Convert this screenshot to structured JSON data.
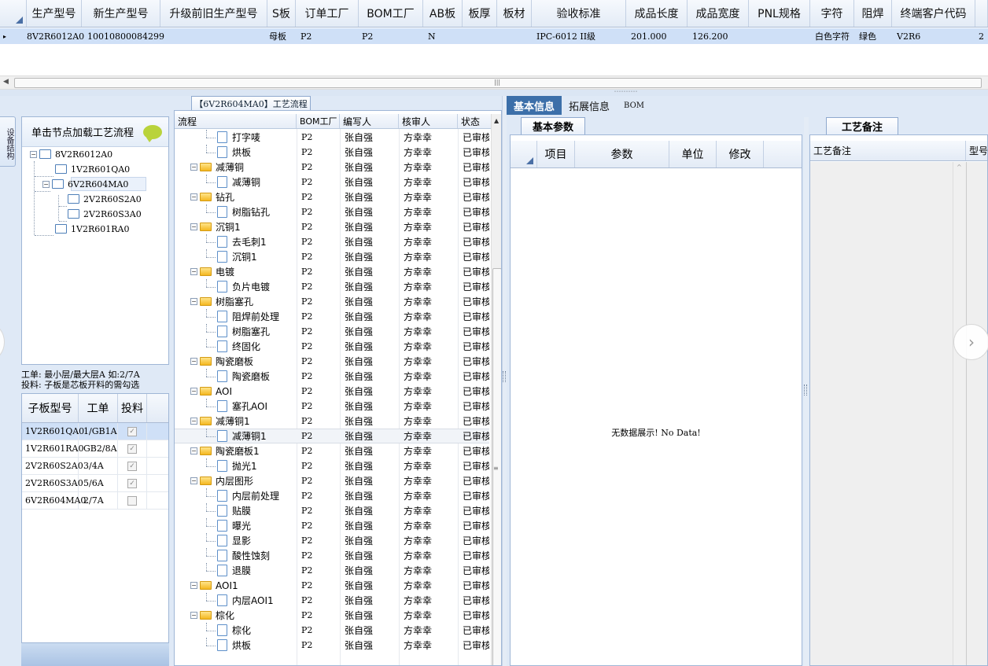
{
  "top_grid": {
    "columns": [
      "生产型号",
      "新生产型号",
      "升级前旧生产型号",
      "S板",
      "订单工厂",
      "BOM工厂",
      "AB板",
      "板厚",
      "板材",
      "验收标准",
      "成品长度",
      "成品宽度",
      "PNL规格",
      "字符",
      "阻焊",
      "终端客户代码"
    ],
    "row": {
      "selector": "▸",
      "cells": [
        "8V2R6012A0",
        "10010800084299",
        "",
        "母板",
        "P2",
        "P2",
        "N",
        "",
        "",
        "IPC-6012 II级",
        "201.000",
        "126.200",
        "",
        "白色字符",
        "绿色",
        "V2R6"
      ],
      "extra": "2"
    }
  },
  "h_splitter_dots": "˙˙˙˙˙˙˙˙˙˙",
  "left": {
    "side_tab": "设备结构",
    "tree_header": "单击节点加载工艺流程",
    "tree_nodes": [
      {
        "label": "8V2R6012A0",
        "expander": "−"
      },
      {
        "label": "1V2R601QA0",
        "expander": ""
      },
      {
        "label": "6V2R604MA0",
        "expander": "−"
      },
      {
        "label": "2V2R60S2A0",
        "expander": ""
      },
      {
        "label": "2V2R60S3A0",
        "expander": ""
      },
      {
        "label": "1V2R601RA0",
        "expander": ""
      }
    ],
    "note_line1": "工单: 最小层/最大层A 如:2/7A",
    "note_line2": "投料: 子板是芯板开料的需勾选",
    "sub_headers": [
      "子板型号",
      "工单",
      "投料"
    ],
    "sub_rows": [
      {
        "model": "1V2R601QA0",
        "order": "1/GB1A",
        "feed": "✓"
      },
      {
        "model": "1V2R601RA0",
        "order": "GB2/8A",
        "feed": "✓"
      },
      {
        "model": "2V2R60S2A0",
        "order": "3/4A",
        "feed": "✓"
      },
      {
        "model": "2V2R60S3A0",
        "order": "5/6A",
        "feed": "✓"
      },
      {
        "model": "6V2R604MA0",
        "order": "2/7A",
        "feed": ""
      }
    ]
  },
  "flow": {
    "tab_title": "【6V2R604MA0】工艺流程",
    "headers": [
      "流程",
      "BOM工厂",
      "编写人",
      "核审人",
      "状态"
    ],
    "scroll_up": "▲",
    "rows": [
      {
        "type": "doc",
        "name": "打字唛",
        "bom": "P2",
        "writer": "张自强",
        "reviewer": "方幸幸",
        "status": "已审核"
      },
      {
        "type": "doc",
        "name": "烘板",
        "bom": "P2",
        "writer": "张自强",
        "reviewer": "方幸幸",
        "status": "已审核"
      },
      {
        "type": "folder",
        "name": "减薄铜",
        "bom": "P2",
        "writer": "张自强",
        "reviewer": "方幸幸",
        "status": "已审核"
      },
      {
        "type": "doc",
        "name": "减薄铜",
        "bom": "P2",
        "writer": "张自强",
        "reviewer": "方幸幸",
        "status": "已审核"
      },
      {
        "type": "folder",
        "name": "钻孔",
        "bom": "P2",
        "writer": "张自强",
        "reviewer": "方幸幸",
        "status": "已审核"
      },
      {
        "type": "doc",
        "name": "树脂钻孔",
        "bom": "P2",
        "writer": "张自强",
        "reviewer": "方幸幸",
        "status": "已审核"
      },
      {
        "type": "folder",
        "name": "沉铜1",
        "bom": "P2",
        "writer": "张自强",
        "reviewer": "方幸幸",
        "status": "已审核"
      },
      {
        "type": "doc",
        "name": "去毛刺1",
        "bom": "P2",
        "writer": "张自强",
        "reviewer": "方幸幸",
        "status": "已审核"
      },
      {
        "type": "doc",
        "name": "沉铜1",
        "bom": "P2",
        "writer": "张自强",
        "reviewer": "方幸幸",
        "status": "已审核"
      },
      {
        "type": "folder",
        "name": "电镀",
        "bom": "P2",
        "writer": "张自强",
        "reviewer": "方幸幸",
        "status": "已审核"
      },
      {
        "type": "doc",
        "name": "负片电镀",
        "bom": "P2",
        "writer": "张自强",
        "reviewer": "方幸幸",
        "status": "已审核"
      },
      {
        "type": "folder",
        "name": "树脂塞孔",
        "bom": "P2",
        "writer": "张自强",
        "reviewer": "方幸幸",
        "status": "已审核"
      },
      {
        "type": "doc",
        "name": "阻焊前处理",
        "bom": "P2",
        "writer": "张自强",
        "reviewer": "方幸幸",
        "status": "已审核"
      },
      {
        "type": "doc",
        "name": "树脂塞孔",
        "bom": "P2",
        "writer": "张自强",
        "reviewer": "方幸幸",
        "status": "已审核"
      },
      {
        "type": "doc",
        "name": "终固化",
        "bom": "P2",
        "writer": "张自强",
        "reviewer": "方幸幸",
        "status": "已审核"
      },
      {
        "type": "folder",
        "name": "陶瓷磨板",
        "bom": "P2",
        "writer": "张自强",
        "reviewer": "方幸幸",
        "status": "已审核"
      },
      {
        "type": "doc",
        "name": "陶瓷磨板",
        "bom": "P2",
        "writer": "张自强",
        "reviewer": "方幸幸",
        "status": "已审核"
      },
      {
        "type": "folder",
        "name": "AOI",
        "bom": "P2",
        "writer": "张自强",
        "reviewer": "方幸幸",
        "status": "已审核"
      },
      {
        "type": "doc",
        "name": "塞孔AOI",
        "bom": "P2",
        "writer": "张自强",
        "reviewer": "方幸幸",
        "status": "已审核"
      },
      {
        "type": "folder",
        "name": "减薄铜1",
        "bom": "P2",
        "writer": "张自强",
        "reviewer": "方幸幸",
        "status": "已审核"
      },
      {
        "type": "doc",
        "name": "减薄铜1",
        "bom": "P2",
        "writer": "张自强",
        "reviewer": "方幸幸",
        "status": "已审核"
      },
      {
        "type": "folder",
        "name": "陶瓷磨板1",
        "bom": "P2",
        "writer": "张自强",
        "reviewer": "方幸幸",
        "status": "已审核"
      },
      {
        "type": "doc",
        "name": "抛光1",
        "bom": "P2",
        "writer": "张自强",
        "reviewer": "方幸幸",
        "status": "已审核"
      },
      {
        "type": "folder",
        "name": "内层图形",
        "bom": "P2",
        "writer": "张自强",
        "reviewer": "方幸幸",
        "status": "已审核"
      },
      {
        "type": "doc",
        "name": "内层前处理",
        "bom": "P2",
        "writer": "张自强",
        "reviewer": "方幸幸",
        "status": "已审核"
      },
      {
        "type": "doc",
        "name": "贴膜",
        "bom": "P2",
        "writer": "张自强",
        "reviewer": "方幸幸",
        "status": "已审核"
      },
      {
        "type": "doc",
        "name": "曝光",
        "bom": "P2",
        "writer": "张自强",
        "reviewer": "方幸幸",
        "status": "已审核"
      },
      {
        "type": "doc",
        "name": "显影",
        "bom": "P2",
        "writer": "张自强",
        "reviewer": "方幸幸",
        "status": "已审核"
      },
      {
        "type": "doc",
        "name": "酸性蚀刻",
        "bom": "P2",
        "writer": "张自强",
        "reviewer": "方幸幸",
        "status": "已审核"
      },
      {
        "type": "doc",
        "name": "退膜",
        "bom": "P2",
        "writer": "张自强",
        "reviewer": "方幸幸",
        "status": "已审核"
      },
      {
        "type": "folder",
        "name": "AOI1",
        "bom": "P2",
        "writer": "张自强",
        "reviewer": "方幸幸",
        "status": "已审核"
      },
      {
        "type": "doc",
        "name": "内层AOI1",
        "bom": "P2",
        "writer": "张自强",
        "reviewer": "方幸幸",
        "status": "已审核"
      },
      {
        "type": "folder",
        "name": "棕化",
        "bom": "P2",
        "writer": "张自强",
        "reviewer": "方幸幸",
        "status": "已审核"
      },
      {
        "type": "doc",
        "name": "棕化",
        "bom": "P2",
        "writer": "张自强",
        "reviewer": "方幸幸",
        "status": "已审核"
      },
      {
        "type": "doc",
        "name": "烘板",
        "bom": "P2",
        "writer": "张自强",
        "reviewer": "方幸幸",
        "status": "已审核"
      }
    ]
  },
  "right": {
    "tabs": [
      "基本信息",
      "拓展信息",
      "BOM"
    ],
    "basic_tab": "基本参数",
    "basic_headers": [
      "项目",
      "参数",
      "单位",
      "修改"
    ],
    "no_data": "无数据展示! No Data!",
    "notes_tab": "工艺备注",
    "notes_headers": [
      "工艺备注",
      "型号"
    ]
  },
  "nav": {
    "next": "›"
  },
  "colors": {
    "accent": "#3c6fa9",
    "selected_row": "#cfe0f7",
    "panel_bg": "#dfe9f6",
    "folder": "#f4b820"
  }
}
